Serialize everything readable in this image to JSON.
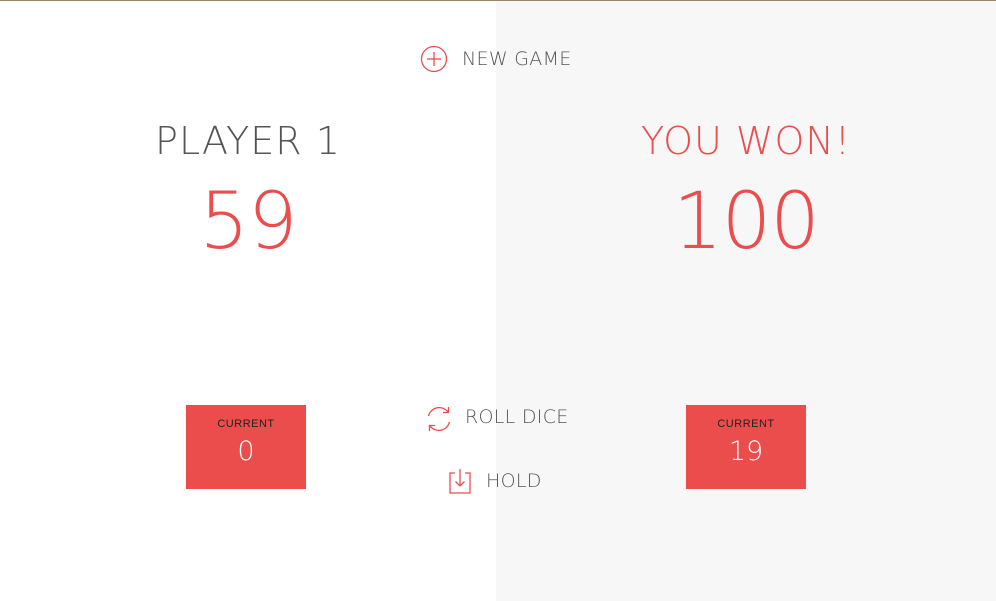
{
  "controls": {
    "new_game_label": "NEW GAME",
    "roll_dice_label": "ROLL DICE",
    "hold_label": "HOLD"
  },
  "players": [
    {
      "name": "PLAYER 1",
      "score": "59",
      "current_label": "CURRENT",
      "current_score": "0"
    },
    {
      "name": "YOU WON!",
      "score": "100",
      "current_label": "CURRENT",
      "current_score": "19"
    }
  ],
  "colors": {
    "accent": "#eb4d4d",
    "text": "#555555",
    "active_panel_bg": "#f7f7f7",
    "panel_bg": "#ffffff"
  },
  "icons": {
    "new_game": "plus-circle-icon",
    "roll_dice": "refresh-icon",
    "hold": "download-icon"
  }
}
